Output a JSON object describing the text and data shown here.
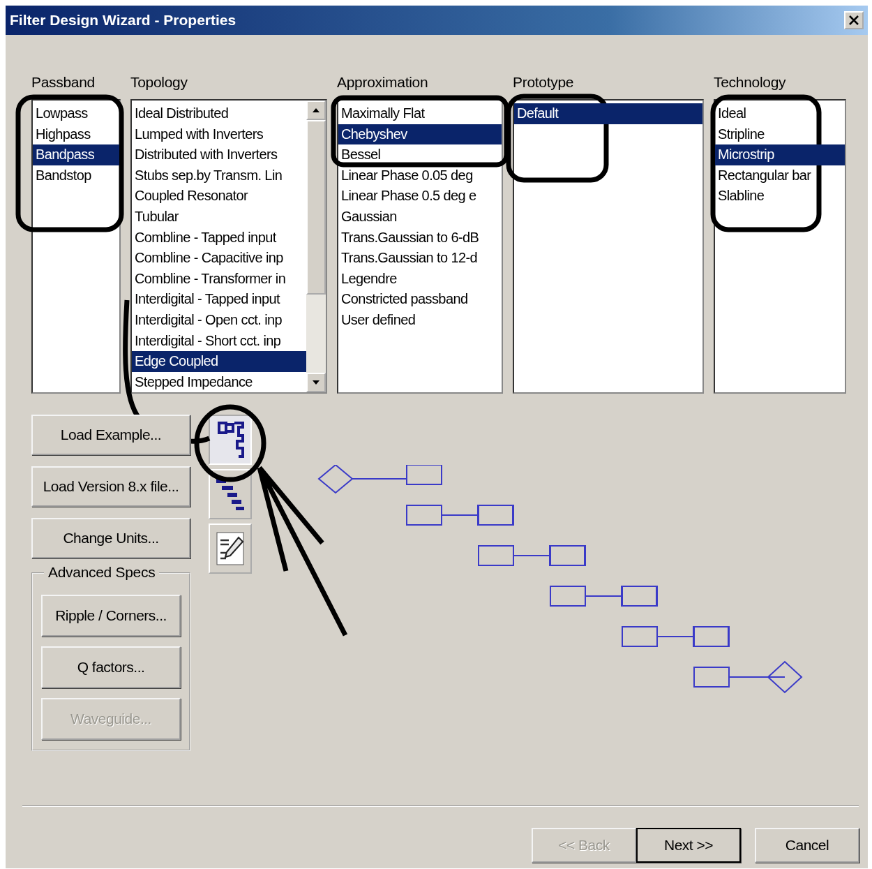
{
  "window": {
    "title": "Filter Design Wizard - Properties"
  },
  "lists": [
    {
      "label": "Passband",
      "scrollable": false,
      "items": [
        {
          "text": "Lowpass",
          "selected": false
        },
        {
          "text": "Highpass",
          "selected": false
        },
        {
          "text": "Bandpass",
          "selected": true
        },
        {
          "text": "Bandstop",
          "selected": false
        }
      ]
    },
    {
      "label": "Topology",
      "scrollable": true,
      "items": [
        {
          "text": "Ideal Distributed",
          "selected": false
        },
        {
          "text": "Lumped with Inverters",
          "selected": false
        },
        {
          "text": "Distributed with Inverters",
          "selected": false
        },
        {
          "text": "Stubs sep.by Transm. Lin",
          "selected": false
        },
        {
          "text": "Coupled Resonator",
          "selected": false
        },
        {
          "text": "Tubular",
          "selected": false
        },
        {
          "text": "Combline - Tapped input",
          "selected": false
        },
        {
          "text": "Combline - Capacitive inp",
          "selected": false
        },
        {
          "text": "Combline - Transformer in",
          "selected": false
        },
        {
          "text": "Interdigital - Tapped input",
          "selected": false
        },
        {
          "text": "Interdigital - Open cct. inp",
          "selected": false
        },
        {
          "text": "Interdigital - Short cct. inp",
          "selected": false
        },
        {
          "text": "Edge Coupled",
          "selected": true
        },
        {
          "text": "Stepped Impedance",
          "selected": false
        }
      ]
    },
    {
      "label": "Approximation",
      "scrollable": false,
      "items": [
        {
          "text": "Maximally Flat",
          "selected": false
        },
        {
          "text": "Chebyshev",
          "selected": true
        },
        {
          "text": "Bessel",
          "selected": false
        },
        {
          "text": "Linear Phase 0.05 deg",
          "selected": false
        },
        {
          "text": "Linear Phase 0.5 deg e",
          "selected": false
        },
        {
          "text": "Gaussian",
          "selected": false
        },
        {
          "text": "Trans.Gaussian to 6-dB",
          "selected": false
        },
        {
          "text": "Trans.Gaussian to 12-d",
          "selected": false
        },
        {
          "text": "Legendre",
          "selected": false
        },
        {
          "text": "Constricted passband",
          "selected": false
        },
        {
          "text": "User defined",
          "selected": false
        }
      ]
    },
    {
      "label": "Prototype",
      "scrollable": false,
      "items": [
        {
          "text": "Default",
          "selected": true
        }
      ]
    },
    {
      "label": "Technology",
      "scrollable": false,
      "items": [
        {
          "text": "Ideal",
          "selected": false
        },
        {
          "text": "Stripline",
          "selected": false
        },
        {
          "text": "Microstrip",
          "selected": true
        },
        {
          "text": "Rectangular bar",
          "selected": false
        },
        {
          "text": "Slabline",
          "selected": false
        }
      ]
    }
  ],
  "buttons": [
    {
      "label": "Load Example...",
      "disabled": false
    },
    {
      "label": "Load Version 8.x file...",
      "disabled": false
    },
    {
      "label": "Change Units...",
      "disabled": false
    }
  ],
  "advanced": {
    "label": "Advanced Specs",
    "buttons": [
      {
        "label": "Ripple / Corners...",
        "disabled": false
      },
      {
        "label": "Q factors...",
        "disabled": false
      },
      {
        "label": "Waveguide...",
        "disabled": true
      }
    ]
  },
  "view_buttons": [
    {
      "kind": "layout",
      "selected": true
    },
    {
      "kind": "schematic",
      "selected": false
    },
    {
      "kind": "equation",
      "selected": false
    }
  ],
  "footer_buttons": [
    {
      "label": "<< Back",
      "disabled": true,
      "default": false
    },
    {
      "label": "Next >>",
      "disabled": false,
      "default": true
    },
    {
      "label": "Cancel",
      "disabled": false,
      "default": false
    }
  ]
}
